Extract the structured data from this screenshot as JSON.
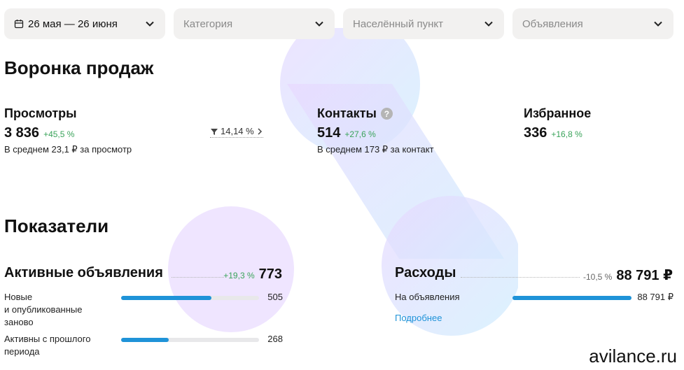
{
  "filters": {
    "date_range": "26 мая — 26 июня",
    "category": "Категория",
    "locality": "Населённый пункт",
    "ads": "Объявления"
  },
  "funnel": {
    "heading": "Воронка продаж",
    "views": {
      "title": "Просмотры",
      "value": "3 836",
      "delta": "+45,5 %",
      "sub": "В среднем 23,1 ₽ за просмотр"
    },
    "conversion": "14,14 %",
    "contacts": {
      "title": "Контакты",
      "value": "514",
      "delta": "+27,6 %",
      "sub": "В среднем 173 ₽ за контакт"
    },
    "favorites": {
      "title": "Избранное",
      "value": "336",
      "delta": "+16,8 %"
    }
  },
  "indicators": {
    "heading": "Показатели",
    "active_ads": {
      "title": "Активные объявления",
      "delta": "+19,3 %",
      "total": "773",
      "rows": [
        {
          "label": "Новые\nи опубликованные\nзаново",
          "value": "505",
          "fraction": 0.653
        },
        {
          "label": "Активны с прошлого\nпериода",
          "value": "268",
          "fraction": 0.347
        }
      ]
    },
    "expenses": {
      "title": "Расходы",
      "delta": "-10,5 %",
      "total": "88 791 ₽",
      "rows": [
        {
          "label": "На объявления",
          "value": "88 791 ₽",
          "fraction": 1.0
        }
      ],
      "more_link": "Подробнее"
    }
  },
  "brand": "avilance.ru",
  "colors": {
    "accent": "#1f93d8",
    "positive": "#3aa35a",
    "filter_bg": "#f2f1f0",
    "track": "#e8e8ea"
  }
}
